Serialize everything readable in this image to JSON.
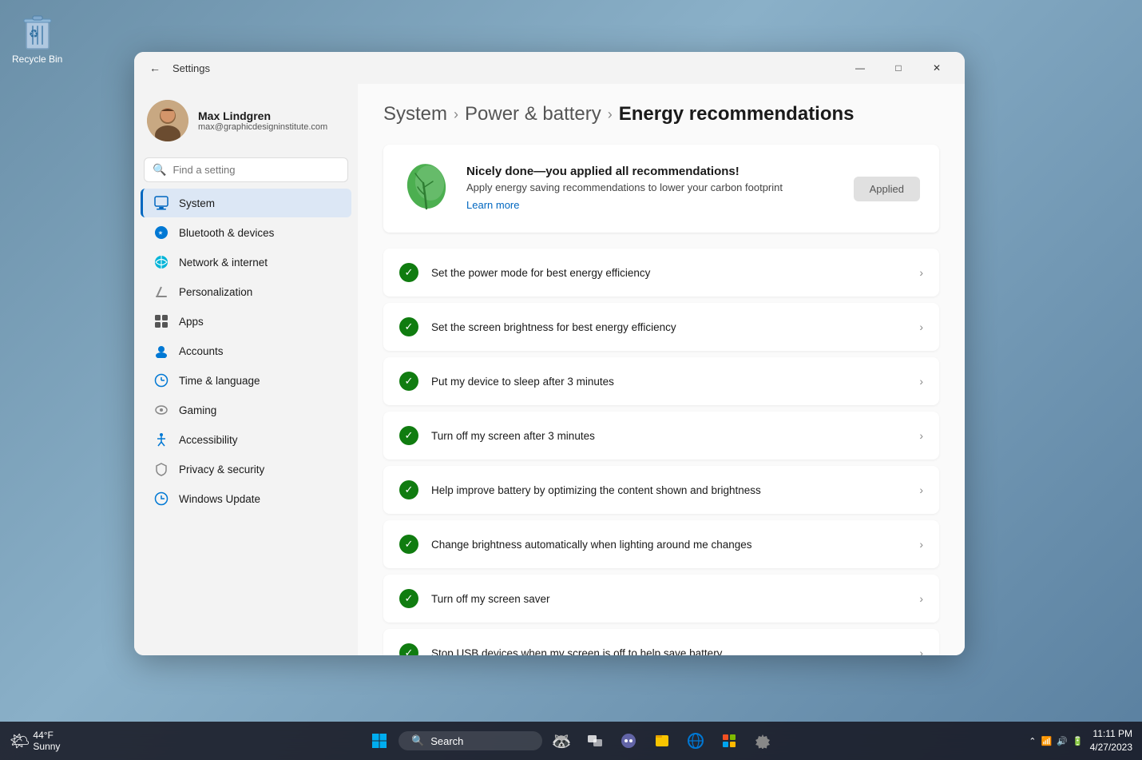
{
  "desktop": {
    "recycle_bin_label": "Recycle Bin"
  },
  "taskbar": {
    "weather_temp": "44°F",
    "weather_condition": "Sunny",
    "search_placeholder": "Search",
    "time": "11:11 PM",
    "date": "4/27/2023"
  },
  "window": {
    "title": "Settings",
    "back_button": "←",
    "minimize": "—",
    "maximize": "□",
    "close": "✕"
  },
  "user": {
    "name": "Max Lindgren",
    "email": "max@graphicdesigninstitute.com"
  },
  "search": {
    "placeholder": "Find a setting"
  },
  "nav": {
    "items": [
      {
        "id": "system",
        "label": "System",
        "active": true
      },
      {
        "id": "bluetooth",
        "label": "Bluetooth & devices"
      },
      {
        "id": "network",
        "label": "Network & internet"
      },
      {
        "id": "personalization",
        "label": "Personalization"
      },
      {
        "id": "apps",
        "label": "Apps"
      },
      {
        "id": "accounts",
        "label": "Accounts"
      },
      {
        "id": "time",
        "label": "Time & language"
      },
      {
        "id": "gaming",
        "label": "Gaming"
      },
      {
        "id": "accessibility",
        "label": "Accessibility"
      },
      {
        "id": "privacy",
        "label": "Privacy & security"
      },
      {
        "id": "update",
        "label": "Windows Update"
      }
    ]
  },
  "breadcrumb": {
    "system": "System",
    "power": "Power & battery",
    "current": "Energy recommendations"
  },
  "banner": {
    "title": "Nicely done—you applied all recommendations!",
    "subtitle": "Apply energy saving recommendations to lower your carbon footprint",
    "learn_more": "Learn more",
    "applied_label": "Applied"
  },
  "recommendations": [
    {
      "id": "power-mode",
      "text": "Set the power mode for best energy efficiency"
    },
    {
      "id": "brightness",
      "text": "Set the screen brightness for best energy efficiency"
    },
    {
      "id": "sleep",
      "text": "Put my device to sleep after 3 minutes"
    },
    {
      "id": "screen-off",
      "text": "Turn off my screen after 3 minutes"
    },
    {
      "id": "battery-opt",
      "text": "Help improve battery by optimizing the content shown and brightness"
    },
    {
      "id": "auto-brightness",
      "text": "Change brightness automatically when lighting around me changes"
    },
    {
      "id": "screen-saver",
      "text": "Turn off my screen saver"
    },
    {
      "id": "usb",
      "text": "Stop USB devices when my screen is off to help save battery"
    }
  ]
}
